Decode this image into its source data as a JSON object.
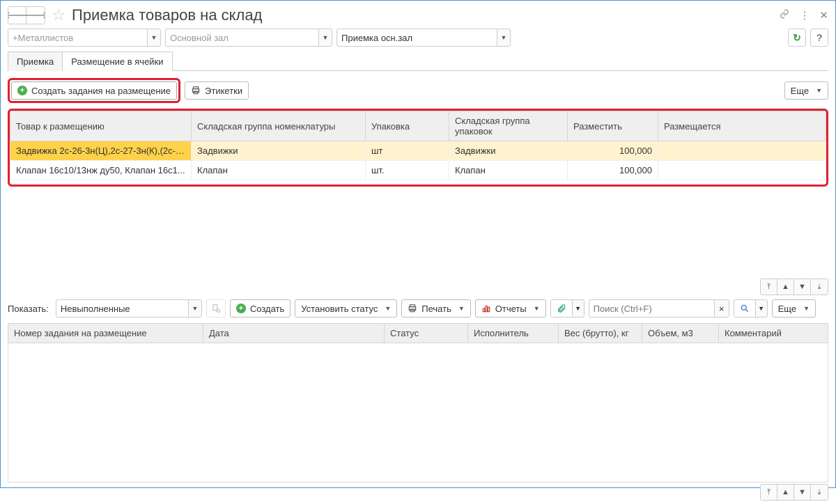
{
  "title": "Приемка товаров на склад",
  "filters": {
    "warehouse": "+Металлистов",
    "room": "Основной зал",
    "zone_label": "Приемка осн.зал"
  },
  "tabs": {
    "t1": "Приемка",
    "t2": "Размещение в ячейки"
  },
  "toolbar1": {
    "create_task": "Создать задания на размещение",
    "labels": "Этикетки",
    "more": "Еще"
  },
  "grid1": {
    "headers": {
      "item": "Товар к размещению",
      "group_nom": "Складская группа номенклатуры",
      "pack": "Упаковка",
      "group_pack": "Складская группа упаковок",
      "to_place": "Разместить",
      "placing": "Размещается"
    },
    "rows": [
      {
        "item": "Задвижка 2с-26-3н(Ц),2с-27-3н(К),(2с-2...",
        "group_nom": "Задвижки",
        "pack": "шт",
        "group_pack": "Задвижки",
        "to_place": "100,000",
        "placing": ""
      },
      {
        "item": "Клапан 16с10/13нж ду50, Клапан 16с1...",
        "group_nom": "Клапан",
        "pack": "шт.",
        "group_pack": "Клапан",
        "to_place": "100,000",
        "placing": ""
      }
    ]
  },
  "toolbar2": {
    "show_label": "Показать:",
    "show_value": "Невыполненные",
    "create": "Создать",
    "set_status": "Установить статус",
    "print": "Печать",
    "reports": "Отчеты",
    "search_placeholder": "Поиск (Ctrl+F)",
    "more": "Еще"
  },
  "grid2": {
    "headers": {
      "task_no": "Номер задания на размещение",
      "date": "Дата",
      "status": "Статус",
      "executor": "Исполнитель",
      "weight": "Вес (брутто), кг",
      "volume": "Объем, м3",
      "comment": "Комментарий"
    }
  }
}
